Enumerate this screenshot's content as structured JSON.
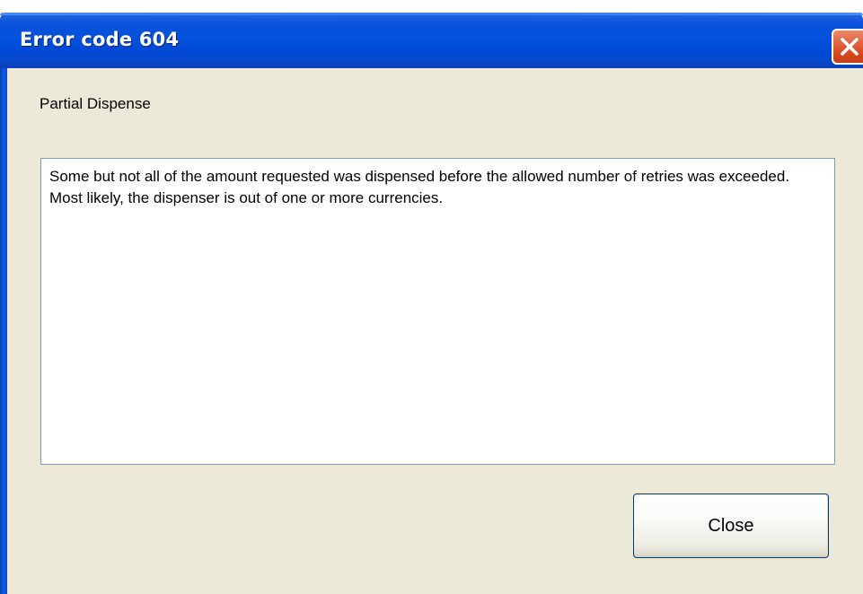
{
  "window": {
    "title": "Error code 604",
    "close_icon": "close-x-icon",
    "titlebar_color": "#0452dc",
    "close_color": "#e2633f"
  },
  "content": {
    "subtitle": "Partial Dispense",
    "message": "Some but not all of the amount requested was dispensed before the allowed number of retries was exceeded. Most likely, the dispenser is out of one or more currencies.",
    "background_color": "#ece9d8"
  },
  "actions": {
    "close_label": "Close"
  }
}
